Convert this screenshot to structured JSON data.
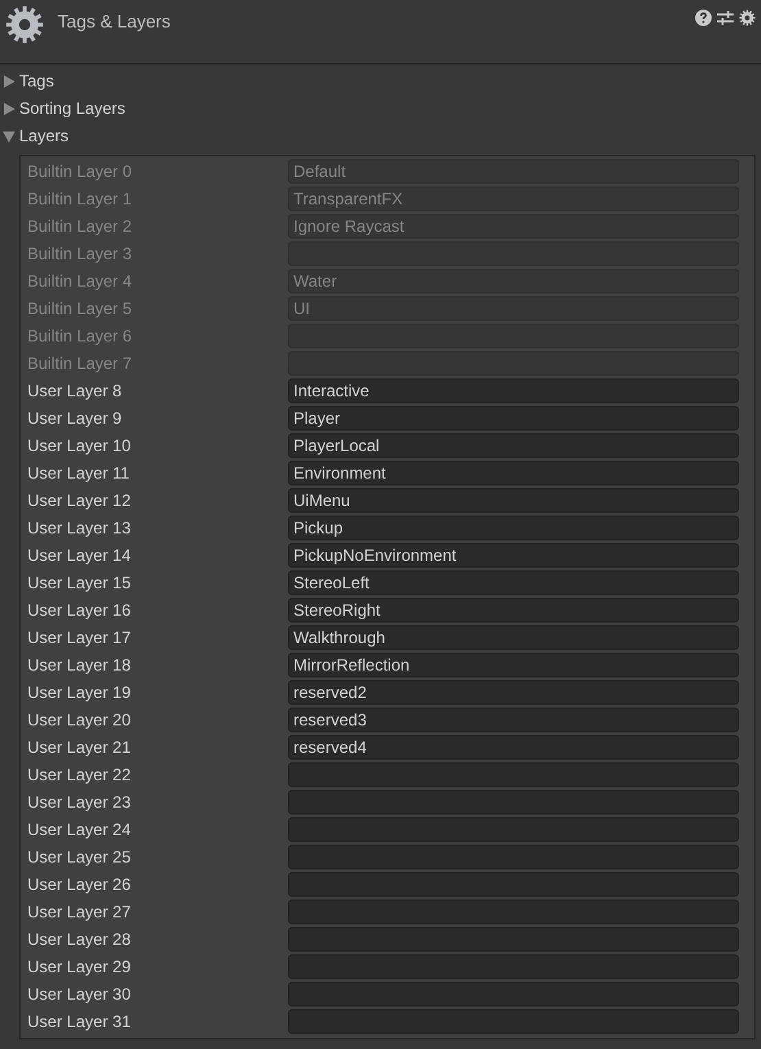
{
  "header": {
    "title": "Tags & Layers"
  },
  "foldouts": [
    {
      "label": "Tags",
      "expanded": false
    },
    {
      "label": "Sorting Layers",
      "expanded": false
    },
    {
      "label": "Layers",
      "expanded": true
    }
  ],
  "layers": [
    {
      "label": "Builtin Layer 0",
      "value": "Default",
      "disabled": true
    },
    {
      "label": "Builtin Layer 1",
      "value": "TransparentFX",
      "disabled": true
    },
    {
      "label": "Builtin Layer 2",
      "value": "Ignore Raycast",
      "disabled": true
    },
    {
      "label": "Builtin Layer 3",
      "disabled": true
    },
    {
      "label": "Builtin Layer 4",
      "value": "Water",
      "disabled": true
    },
    {
      "label": "Builtin Layer 5",
      "value": "UI",
      "disabled": true
    },
    {
      "label": "Builtin Layer 6",
      "disabled": true
    },
    {
      "label": "Builtin Layer 7",
      "disabled": true
    },
    {
      "label": "User Layer 8",
      "value": "Interactive",
      "disabled": false
    },
    {
      "label": "User Layer 9",
      "value": "Player",
      "disabled": false
    },
    {
      "label": "User Layer 10",
      "value": "PlayerLocal",
      "disabled": false
    },
    {
      "label": "User Layer 11",
      "value": "Environment",
      "disabled": false
    },
    {
      "label": "User Layer 12",
      "value": "UiMenu",
      "disabled": false
    },
    {
      "label": "User Layer 13",
      "value": "Pickup",
      "disabled": false
    },
    {
      "label": "User Layer 14",
      "value": "PickupNoEnvironment",
      "disabled": false
    },
    {
      "label": "User Layer 15",
      "value": "StereoLeft",
      "disabled": false
    },
    {
      "label": "User Layer 16",
      "value": "StereoRight",
      "disabled": false
    },
    {
      "label": "User Layer 17",
      "value": "Walkthrough",
      "disabled": false
    },
    {
      "label": "User Layer 18",
      "value": "MirrorReflection",
      "disabled": false
    },
    {
      "label": "User Layer 19",
      "value": "reserved2",
      "disabled": false
    },
    {
      "label": "User Layer 20",
      "value": "reserved3",
      "disabled": false
    },
    {
      "label": "User Layer 21",
      "value": "reserved4",
      "disabled": false
    },
    {
      "label": "User Layer 22",
      "disabled": false
    },
    {
      "label": "User Layer 23",
      "disabled": false
    },
    {
      "label": "User Layer 24",
      "disabled": false
    },
    {
      "label": "User Layer 25",
      "disabled": false
    },
    {
      "label": "User Layer 26",
      "disabled": false
    },
    {
      "label": "User Layer 27",
      "disabled": false
    },
    {
      "label": "User Layer 28",
      "disabled": false
    },
    {
      "label": "User Layer 29",
      "disabled": false
    },
    {
      "label": "User Layer 30",
      "disabled": false
    },
    {
      "label": "User Layer 31",
      "disabled": false
    }
  ]
}
